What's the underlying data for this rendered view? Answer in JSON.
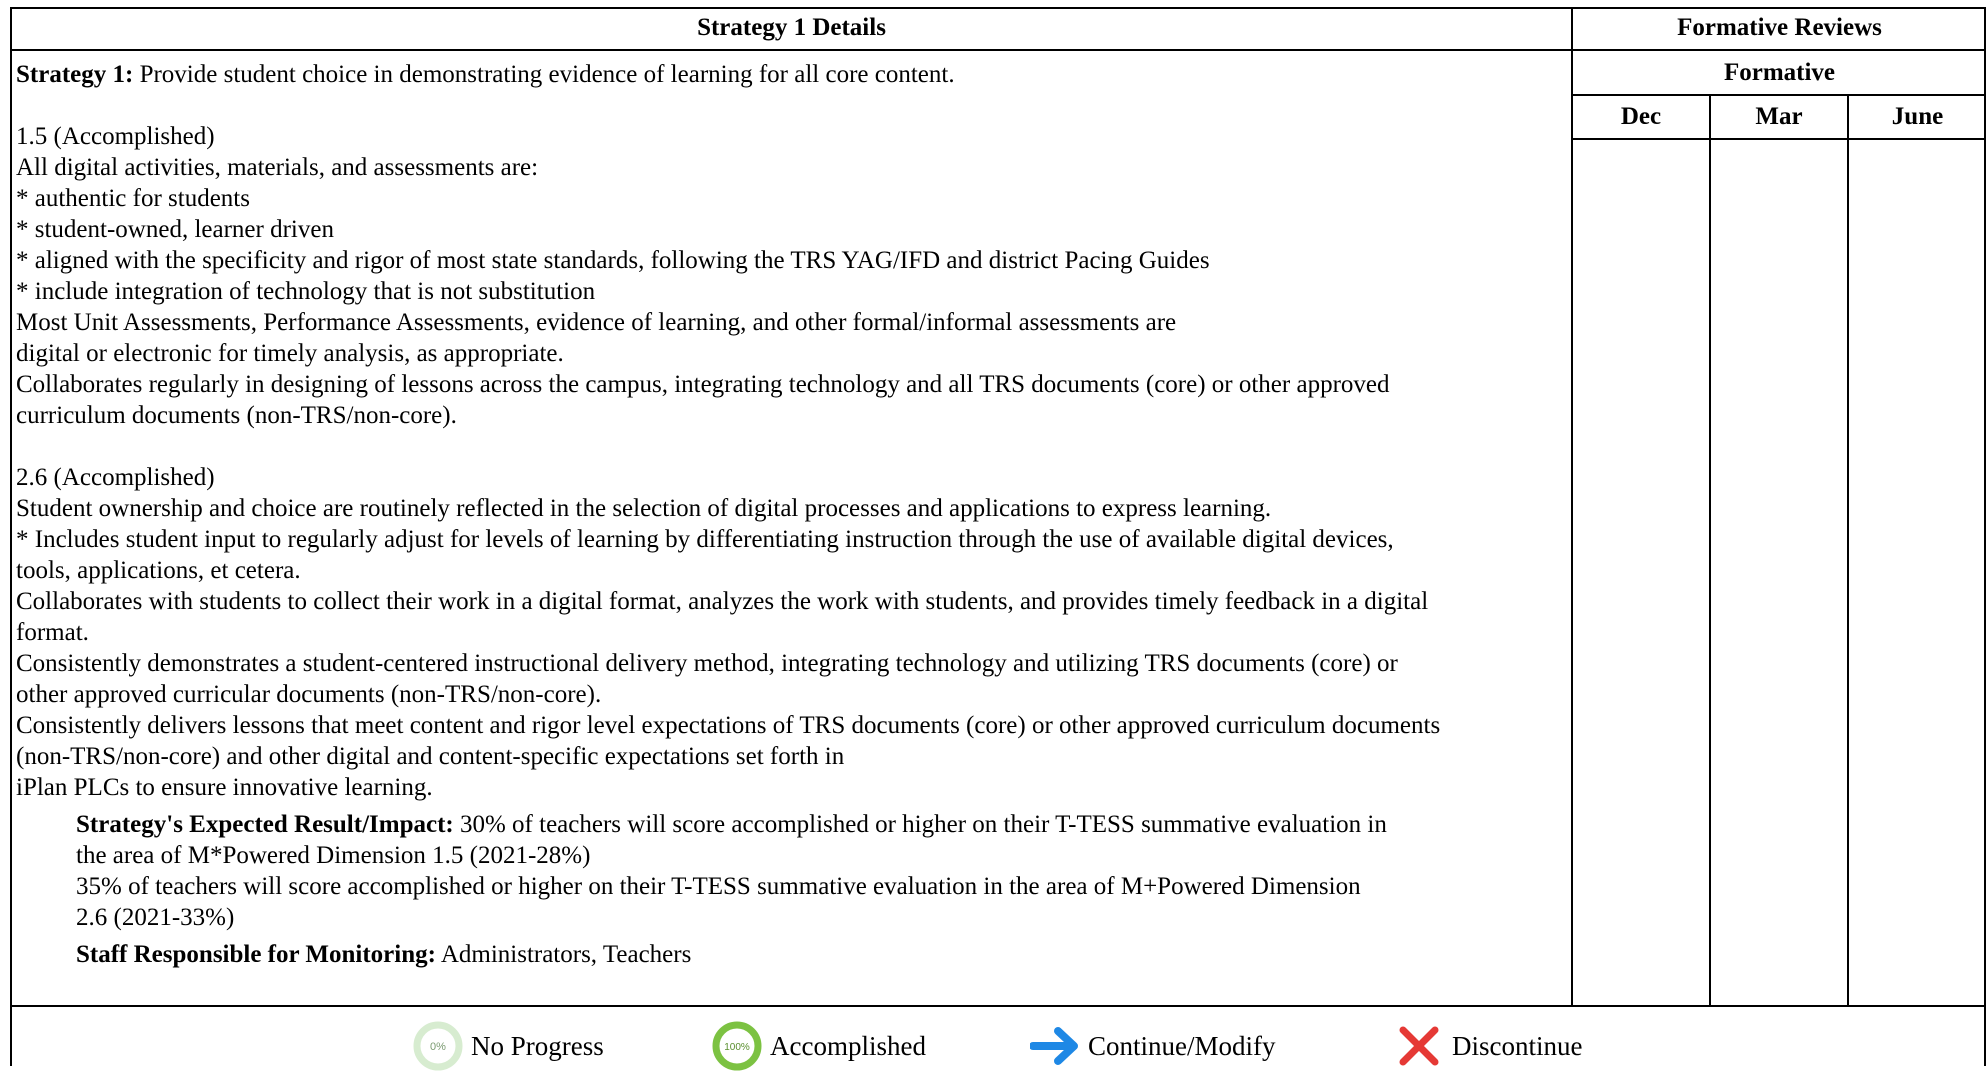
{
  "header": {
    "strategy_title": "Strategy 1 Details",
    "reviews_title": "Formative Reviews",
    "formative_label": "Formative",
    "months": [
      "Dec",
      "Mar",
      "June"
    ]
  },
  "strategy": {
    "label": "Strategy 1:",
    "text": " Provide student choice in demonstrating evidence of learning for all core content."
  },
  "section1": [
    "1.5 (Accomplished)",
    "All digital activities, materials, and assessments are:",
    "* authentic for students",
    "* student-owned, learner driven",
    "* aligned with the specificity and rigor of most state standards, following the TRS YAG/IFD and district Pacing Guides",
    "* include integration of technology that is not substitution",
    "Most Unit Assessments, Performance Assessments, evidence of learning, and other formal/informal assessments are",
    "digital or electronic for timely analysis, as appropriate.",
    "Collaborates regularly in designing of lessons across the campus, integrating technology and all TRS documents (core) or other approved",
    "curriculum documents (non-TRS/non-core)."
  ],
  "section2": [
    "2.6 (Accomplished)",
    "Student ownership and choice are routinely reflected in the selection of digital processes and applications to express learning.",
    "* Includes student input to regularly adjust for levels of learning by differentiating instruction through the use of available digital devices,",
    "tools, applications, et cetera.",
    "Collaborates with students to collect their work in a digital format, analyzes the work with students, and provides timely feedback in a digital",
    "format.",
    "Consistently demonstrates a student-centered instructional delivery method, integrating technology and utilizing TRS documents (core) or",
    "other approved curricular documents (non-TRS/non-core).",
    "Consistently delivers lessons that meet content and rigor level expectations of TRS documents (core) or other approved curriculum documents",
    "(non-TRS/non-core) and other digital and content-specific expectations set forth in",
    "iPlan PLCs to ensure innovative learning."
  ],
  "expected": {
    "label": "Strategy's Expected Result/Impact:",
    "lines": [
      " 30% of teachers will score accomplished or higher on their T-TESS summative evaluation in",
      "the area of M*Powered Dimension 1.5 (2021-28%)",
      "35% of teachers will score accomplished or higher on their T-TESS summative evaluation in the area of M+Powered Dimension",
      "2.6 (2021-33%)"
    ]
  },
  "staff": {
    "label": "Staff Responsible for Monitoring:",
    "text": " Administrators, Teachers"
  },
  "legend": {
    "no_progress_icon_text": "0%",
    "no_progress_label": "No Progress",
    "accomplished_icon_text": "100%",
    "accomplished_label": "Accomplished",
    "continue_label": "Continue/Modify",
    "discontinue_label": "Discontinue"
  },
  "colors": {
    "no_progress": "#c8e6c0",
    "accomplished": "#7cc242",
    "continue": "#1e88e5",
    "discontinue": "#e53935"
  }
}
